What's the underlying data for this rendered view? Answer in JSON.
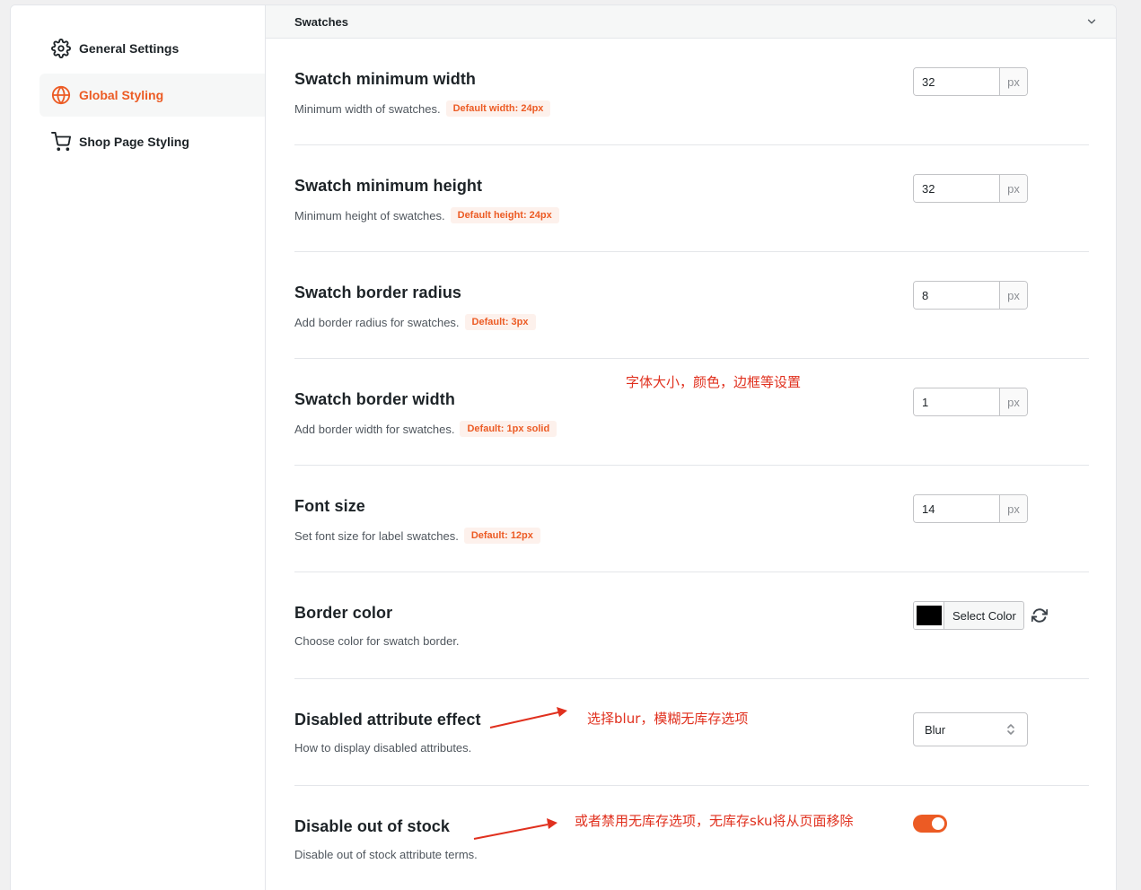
{
  "sidebar": {
    "items": [
      {
        "label": "General Settings",
        "icon": "gear-icon"
      },
      {
        "label": "Global Styling",
        "icon": "globe-icon",
        "active": true
      },
      {
        "label": "Shop Page Styling",
        "icon": "cart-icon"
      }
    ]
  },
  "section": {
    "title": "Swatches"
  },
  "rows": [
    {
      "title": "Swatch minimum width",
      "desc": "Minimum width of swatches.",
      "badge": "Default width: 24px",
      "value": "32",
      "unit": "px"
    },
    {
      "title": "Swatch minimum height",
      "desc": "Minimum height of swatches.",
      "badge": "Default height: 24px",
      "value": "32",
      "unit": "px"
    },
    {
      "title": "Swatch border radius",
      "desc": "Add border radius for swatches.",
      "badge": "Default: 3px",
      "value": "8",
      "unit": "px"
    },
    {
      "title": "Swatch border width",
      "desc": "Add border width for swatches.",
      "badge": "Default: 1px solid",
      "value": "1",
      "unit": "px"
    },
    {
      "title": "Font size",
      "desc": "Set font size for label swatches.",
      "badge": "Default: 12px",
      "value": "14",
      "unit": "px"
    },
    {
      "title": "Border color",
      "desc": "Choose color for swatch border.",
      "color_button": "Select Color",
      "color": "#000000"
    },
    {
      "title": "Disabled attribute effect",
      "desc": "How to display disabled attributes.",
      "select_value": "Blur"
    },
    {
      "title": "Disable out of stock",
      "desc": "Disable out of stock attribute terms.",
      "toggle_on": true
    }
  ],
  "annotations": [
    {
      "text": "字体大小，颜色，边框等设置"
    },
    {
      "text": "选择blur，模糊无库存选项"
    },
    {
      "text": "或者禁用无库存选项，无库存sku将从页面移除"
    }
  ],
  "colors": {
    "accent": "#ec5b24",
    "annotation": "#e0301e"
  }
}
